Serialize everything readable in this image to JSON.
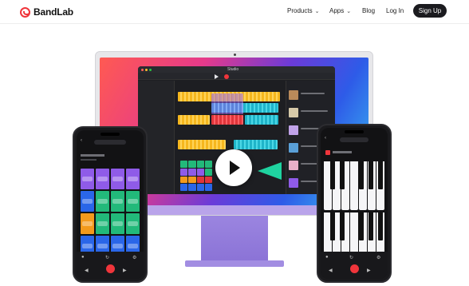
{
  "header": {
    "logo_text": "BandLab",
    "nav": [
      {
        "label": "Products",
        "dropdown": true
      },
      {
        "label": "Apps",
        "dropdown": true
      },
      {
        "label": "Blog",
        "dropdown": false
      },
      {
        "label": "Log In",
        "dropdown": false
      }
    ],
    "signup_label": "Sign Up"
  },
  "daw": {
    "title": "Studio"
  },
  "colors": {
    "brand": "#f0353b",
    "dark_button": "#1b1b1f",
    "stand": "#9b85e0"
  },
  "icons": [
    "bandlab-logo-icon",
    "chevron-down-icon",
    "play-icon",
    "record-icon"
  ]
}
